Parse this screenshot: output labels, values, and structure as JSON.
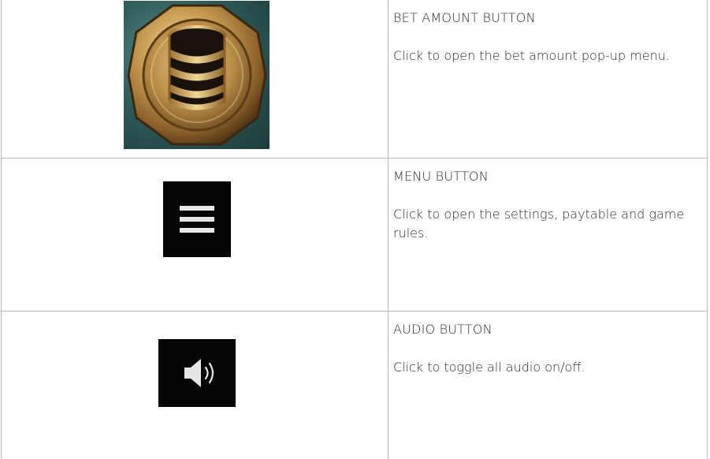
{
  "rows": [
    {
      "icon": "bet-amount-coin-icon",
      "title": "BET AMOUNT BUTTON",
      "description": "Click to open the bet amount pop-up menu."
    },
    {
      "icon": "menu-hamburger-icon",
      "title": "MENU BUTTON",
      "description": "Click to open the settings, paytable and game rules."
    },
    {
      "icon": "speaker-audio-icon",
      "title": "AUDIO BUTTON",
      "description": "Click to toggle all audio on/off."
    }
  ],
  "colors": {
    "border": "#b8b8b8",
    "text": "#2a2a2a",
    "icon_background": "#050505",
    "icon_foreground": "#e6e6e6",
    "coin_gold": "#c9a25a",
    "coin_background": "#2e5a58"
  }
}
